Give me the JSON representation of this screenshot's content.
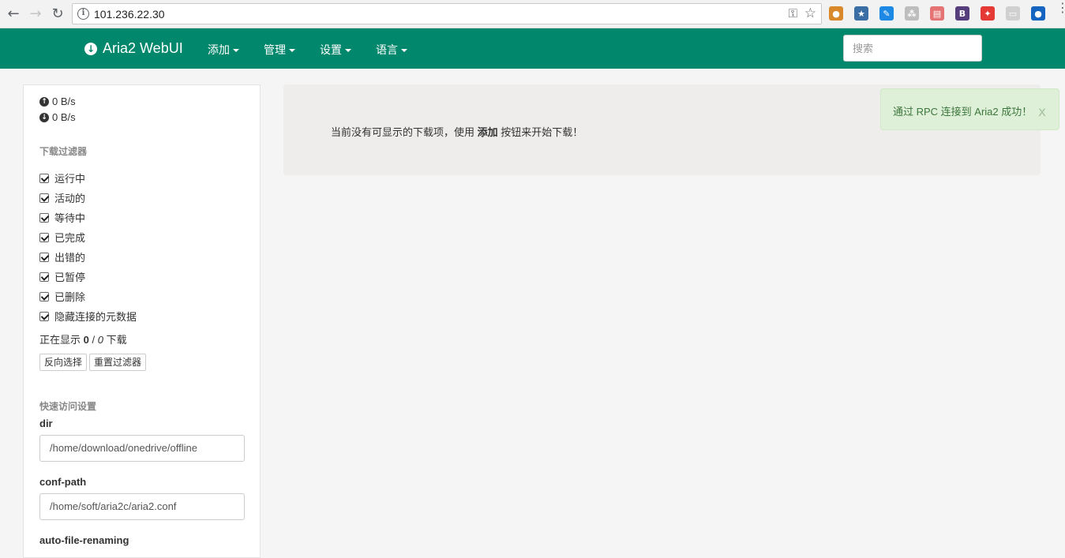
{
  "browser": {
    "url": "101.236.22.30",
    "back_icon": "←",
    "forward_icon": "→",
    "reload_icon": "↻",
    "info_icon": "i",
    "key_icon": "⚿",
    "star_icon": "☆",
    "menu_icon": "⋮",
    "extensions": [
      {
        "name": "cookie-extension-icon",
        "glyph": "●",
        "color": "#d9882b"
      },
      {
        "name": "bookmark-star-extension-icon",
        "glyph": "★",
        "color": "#3b6ea5"
      },
      {
        "name": "blue-pen-extension-icon",
        "glyph": "✎",
        "color": "#1e88e5"
      },
      {
        "name": "tree-extension-icon",
        "glyph": "⁂",
        "color": "#bdbdbd"
      },
      {
        "name": "calendar-extension-icon",
        "glyph": "▤",
        "color": "#e57373"
      },
      {
        "name": "bootstrap-extension-icon",
        "glyph": "B",
        "color": "#563d7c"
      },
      {
        "name": "flame-extension-icon",
        "glyph": "✦",
        "color": "#e53935"
      },
      {
        "name": "gray-extension-icon",
        "glyph": "▭",
        "color": "#d0d0d0"
      },
      {
        "name": "water-drop-extension-icon",
        "glyph": "●",
        "color": "#1565c0"
      }
    ]
  },
  "navbar": {
    "brand": "Aria2 WebUI",
    "brand_icon": "↓",
    "menus": [
      "添加",
      "管理",
      "设置",
      "语言"
    ],
    "search_placeholder": "搜索",
    "bg_color": "#00876c"
  },
  "sidebar": {
    "upload_speed": "0 B/s",
    "download_speed": "0 B/s",
    "upload_icon": "↑",
    "download_icon": "↓",
    "filter_title": "下载过滤器",
    "filters": [
      "运行中",
      "活动的",
      "等待中",
      "已完成",
      "出错的",
      "已暂停",
      "已删除",
      "隐藏连接的元数据"
    ],
    "count_prefix": "正在显示",
    "count_shown": "0",
    "count_sep": " / ",
    "count_total": "0",
    "count_suffix": "下载",
    "invert_button": "反向选择",
    "reset_button": "重置过滤器",
    "quick_title": "快速访问设置",
    "fields": [
      {
        "label": "dir",
        "value": "/home/download/onedrive/offline"
      },
      {
        "label": "conf-path",
        "value": "/home/soft/aria2c/aria2.conf"
      },
      {
        "label": "auto-file-renaming",
        "value": ""
      }
    ]
  },
  "main": {
    "msg_before": "当前没有可显示的下载项，使用 ",
    "msg_bold": "添加",
    "msg_after": " 按钮来开始下载！"
  },
  "alert": {
    "text": "通过 RPC 连接到 Aria2 成功！",
    "close": "x",
    "color": "#3c763d"
  }
}
